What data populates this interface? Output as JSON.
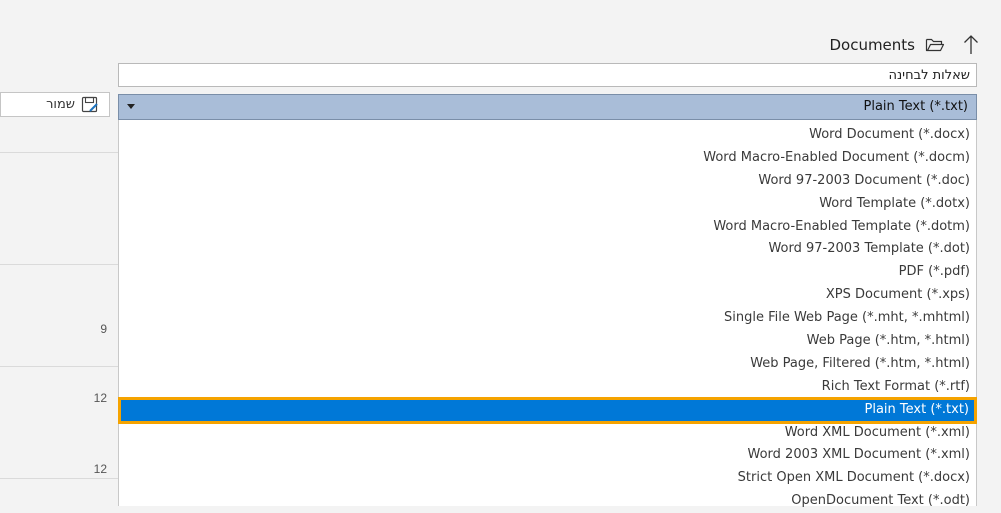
{
  "location": {
    "path_label": "Documents"
  },
  "file_name": {
    "value": "שאלות לבחינה"
  },
  "save_button": {
    "label": "שמור"
  },
  "file_type": {
    "selected": "Plain Text (*.txt)",
    "options": [
      "Word Document (*.docx)",
      "Word Macro-Enabled Document (*.docm)",
      "Word 97-2003 Document (*.doc)",
      "Word Template (*.dotx)",
      "Word Macro-Enabled Template (*.dotm)",
      "Word 97-2003 Template (*.dot)",
      "PDF (*.pdf)",
      "XPS Document (*.xps)",
      "Single File Web Page (*.mht, *.mhtml)",
      "Web Page (*.htm, *.html)",
      "Web Page, Filtered (*.htm, *.html)",
      "Rich Text Format (*.rtf)",
      "Plain Text (*.txt)",
      "Word XML Document (*.xml)",
      "Word 2003 XML Document (*.xml)",
      "Strict Open XML Document (*.docx)",
      "OpenDocument Text (*.odt)"
    ],
    "highlighted_index": 12
  },
  "left_pane": {
    "numbers": [
      "9",
      "12",
      "12"
    ]
  },
  "colors": {
    "selection": "#0078d7",
    "focus_outline": "#f5a300",
    "dropdown_header": "#a9bdd8"
  }
}
